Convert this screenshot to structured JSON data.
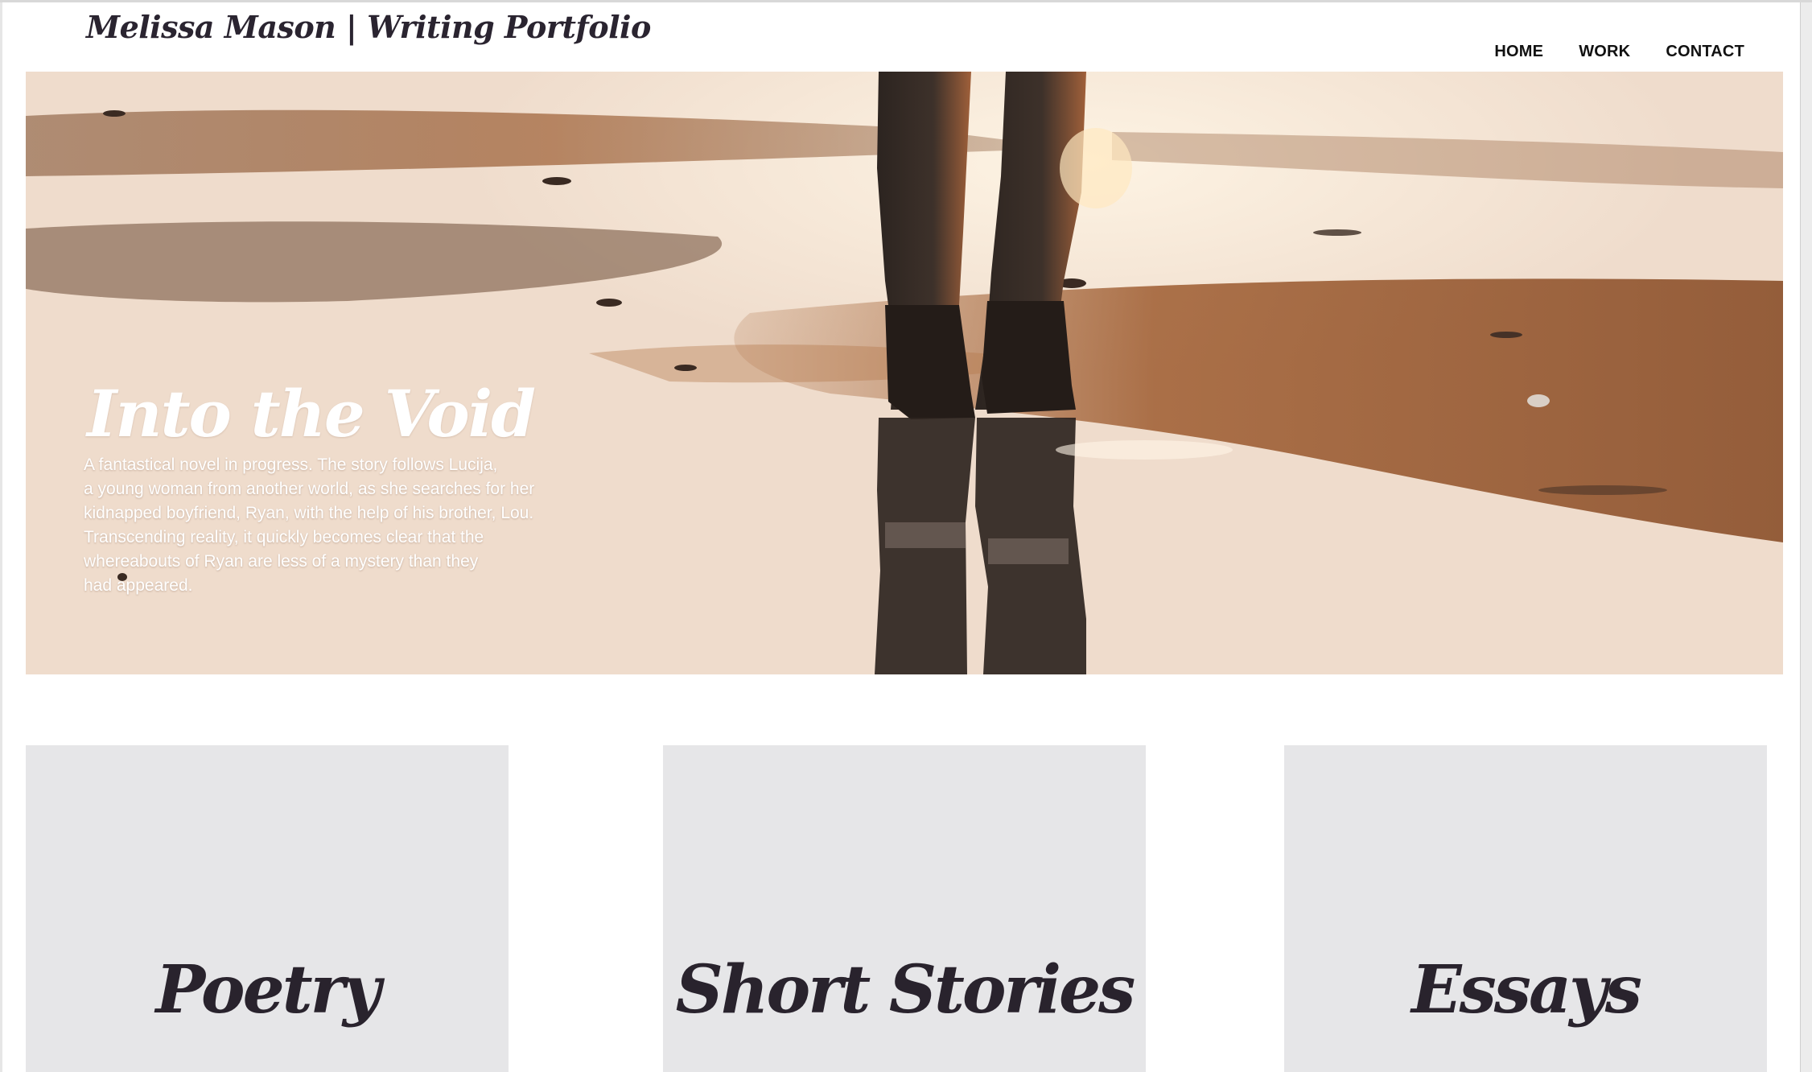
{
  "header": {
    "site_title": "Melissa Mason | Writing Portfolio",
    "nav": [
      {
        "label": "HOME"
      },
      {
        "label": "WORK"
      },
      {
        "label": "CONTACT"
      }
    ]
  },
  "hero": {
    "title": "Into the Void",
    "description_lines": [
      "A fantastical novel in progress. The story follows Lucija,",
      "a young woman from another world, as she searches for her",
      "kidnapped boyfriend, Ryan, with the help of his brother, Lou.",
      "Transcending reality, it quickly becomes clear that the",
      "whereabouts of Ryan are less of a mystery than they",
      "had appeared."
    ],
    "image_icon": "beach-sunset-photo"
  },
  "categories": [
    {
      "label": "Poetry"
    },
    {
      "label": "Short Stories"
    },
    {
      "label": "Essays"
    }
  ],
  "colors": {
    "title_text": "#2a2430",
    "card_bg": "#e6e6e8",
    "hero_text": "#ffffff"
  }
}
